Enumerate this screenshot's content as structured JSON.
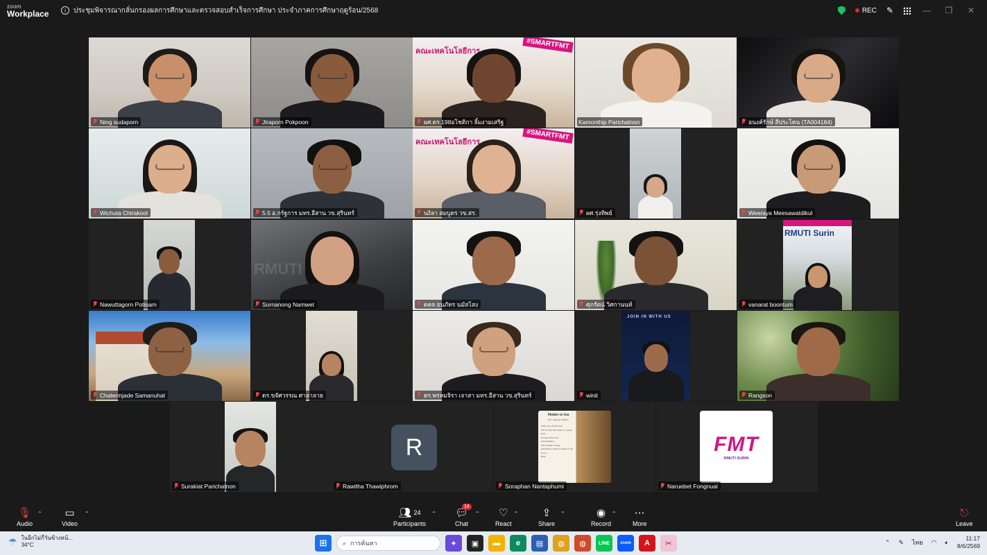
{
  "app": {
    "brand_small": "zoom",
    "brand_big": "Workplace"
  },
  "meeting": {
    "title": "ประชุมพิจารณากลั่นกรองผลการศึกษาและตรวจสอบสำเร็จการศึกษา ประจำภาคการศึกษาฤดูร้อน/2568"
  },
  "titlebar": {
    "rec_label": "REC",
    "minimize": "—",
    "restore": "❐",
    "close": "✕"
  },
  "colors": {
    "active_speaker": "#23d18b",
    "muted": "#e64545",
    "rec": "#e02b2b",
    "secure": "#20c05c"
  },
  "participants": [
    {
      "name": "Ning sudaporn",
      "muted": true
    },
    {
      "name": "Jiraporn Pokpoon",
      "muted": true
    },
    {
      "name": "ผศ.ดร.198อโชติกา ลิ้มงามเสริฐ",
      "muted": true,
      "sign_text": "#SMARTFMT",
      "banner_text": "คณะเทคโนโลยีการ"
    },
    {
      "name": "Kamonthip Parichatnon",
      "muted": false,
      "active_speaker": true
    },
    {
      "name": "อนงค์รักษ์ สีประโคน (TA004184)",
      "muted": true
    },
    {
      "name": "Wichuta Chirakool",
      "muted": true
    },
    {
      "name": "5.5 อ.กร์ฐการ มทร.อีสาน วข.สุรินทร์",
      "muted": true
    },
    {
      "name": "นงิลา สมบูตร วข.สร.",
      "muted": true,
      "sign_text": "#SMARTFMT",
      "banner_text": "คณะเทคโนโลยีการ"
    },
    {
      "name": "ผศ.รุ่งทิพย์",
      "muted": true
    },
    {
      "name": "Weeraya Meesawatdikul",
      "muted": true
    },
    {
      "name": "Nawuttagorn Potisarn",
      "muted": true
    },
    {
      "name": "Sornanong Namwet",
      "muted": true,
      "sign_text": "RMUTI"
    },
    {
      "name": "ดคจ ธนภัทร นมัสโสง",
      "muted": true
    },
    {
      "name": "ศุภรัตน์ วิศกานนท์",
      "muted": true
    },
    {
      "name": "vanarat boontum",
      "muted": true,
      "sign_text": "RMUTI Surin"
    },
    {
      "name": "Chalermjade Samanuhat",
      "muted": true
    },
    {
      "name": "ดร.ขจัศวรรณ ศาลาลาย",
      "muted": true
    },
    {
      "name": "ดร.พรหมจิรา เจาสา มทร.อีสาน วข.สุรินทร์",
      "muted": true
    },
    {
      "name": "winit",
      "muted": true,
      "sign_text": "JOIN IN WITH US"
    },
    {
      "name": "Rangson",
      "muted": true
    },
    {
      "name": "Surakiat Parichatnon",
      "muted": true
    },
    {
      "name": "Rawitha Thawiphrom",
      "muted": true,
      "avatar_letter": "R"
    },
    {
      "name": "Soraphan Nantaphumi",
      "muted": true,
      "poem_title": "Mother to Son",
      "poem_author": "By Langston Hughes",
      "poem_lines": [
        "Well, son, I'll tell you:",
        "Life for me ain't been no crystal stair.",
        "It's had tacks in it,",
        "And splinters,",
        "And boards torn up,",
        "And places with no carpet on the floor—",
        "Bare."
      ]
    },
    {
      "name": "Naruebet Fongnual",
      "muted": true,
      "logo_text": "FMT",
      "logo_sub": "RMUTI SURIN"
    }
  ],
  "toolbar": {
    "audio": "Audio",
    "video": "Video",
    "participants": "Participants",
    "participants_count": "24",
    "chat": "Chat",
    "chat_badge": "14",
    "react": "React",
    "share": "Share",
    "record": "Record",
    "more": "More",
    "leave": "Leave"
  },
  "taskbar": {
    "weather_line1": "ในอีกไม่กี่วันข้างหน้...",
    "weather_line2": "34°C",
    "search_placeholder": "การค้นหา",
    "lang": "ไทย",
    "time": "11:17",
    "date": "8/6/2569"
  }
}
